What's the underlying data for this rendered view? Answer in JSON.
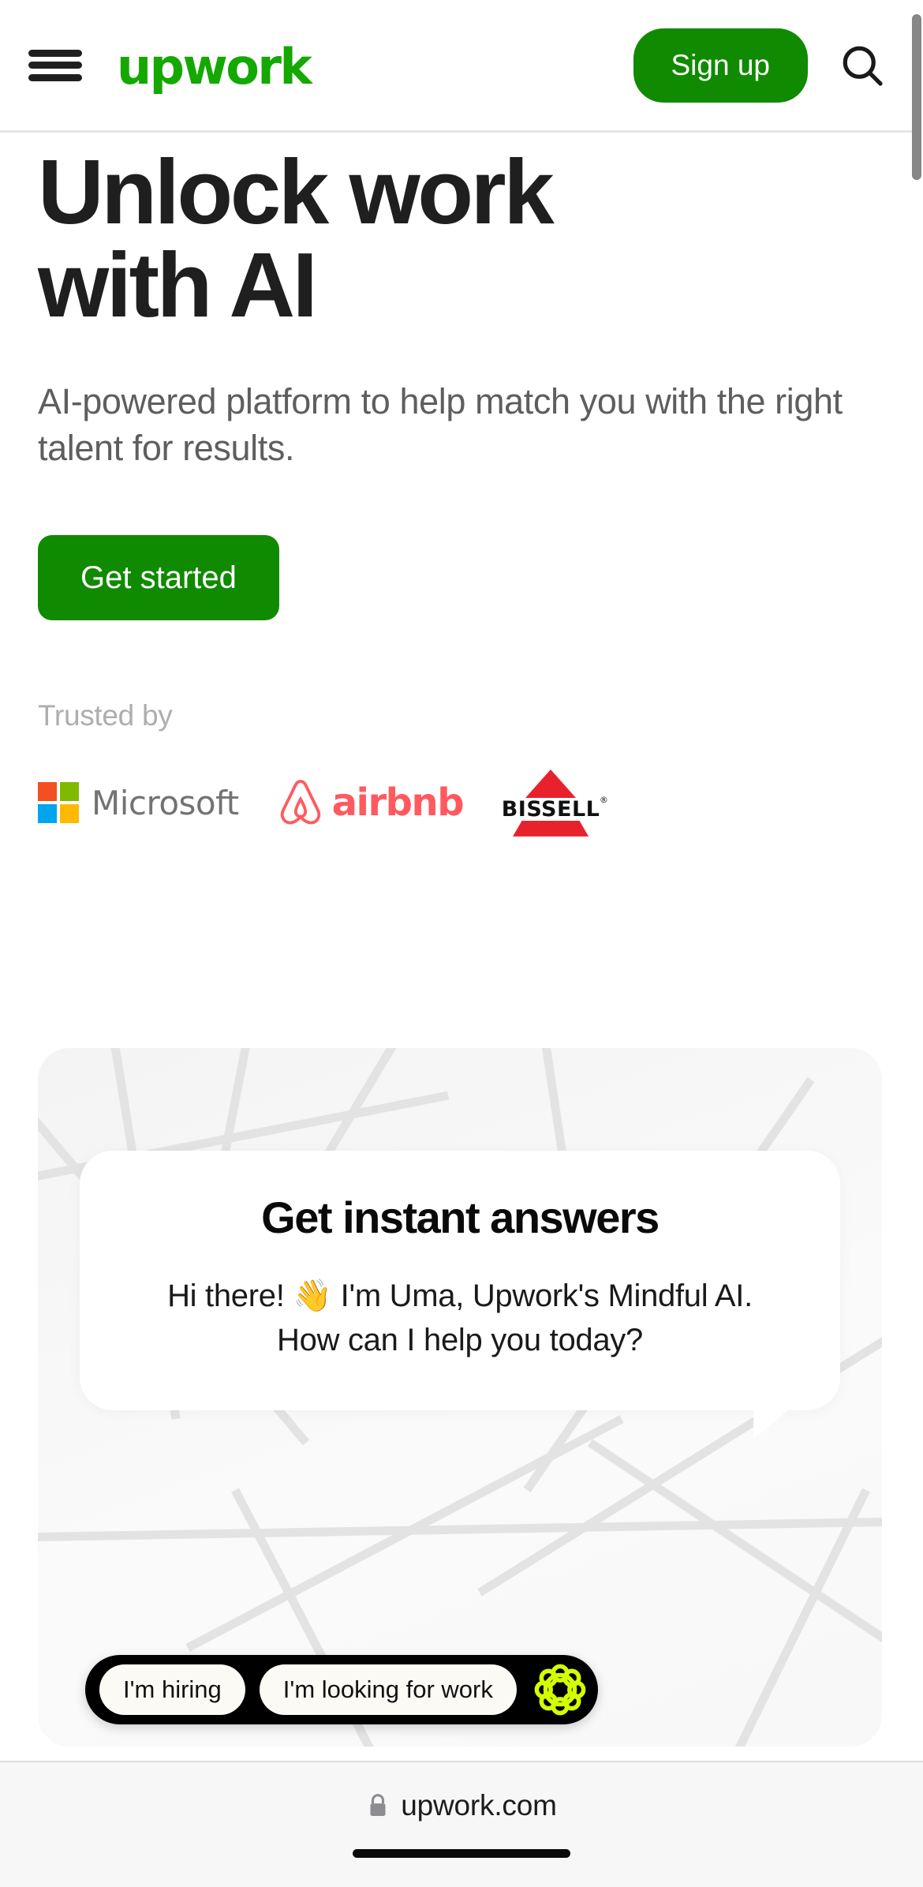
{
  "header": {
    "menu_icon": "hamburger-menu-icon",
    "brand": "upwork",
    "signup_label": "Sign up",
    "search_icon": "search-icon"
  },
  "hero": {
    "title_line1": "Unlock work",
    "title_line2": "with AI",
    "subtitle": "AI-powered platform to help match you with the right talent for results.",
    "cta_label": "Get started",
    "trusted_label": "Trusted by",
    "logos": [
      {
        "name": "Microsoft",
        "word": "Microsoft",
        "colors": [
          "#F25022",
          "#7FBA00",
          "#00A4EF",
          "#FFB900"
        ]
      },
      {
        "name": "airbnb",
        "word": "airbnb",
        "color": "#FF5A5F"
      },
      {
        "name": "BISSELL",
        "word": "BISSELL",
        "registered": "®",
        "color": "#E8222C"
      }
    ]
  },
  "chat": {
    "title": "Get instant answers",
    "message_line1": "Hi there! 👋 I'm Uma, Upwork's Mindful",
    "message_line2": "AI.",
    "message_line3": "How can I help you today?",
    "chips": [
      {
        "label": "I'm hiring"
      },
      {
        "label": "I'm looking for work"
      }
    ],
    "assistant_icon": "uma-logo-icon",
    "assistant_icon_color": "#D4FF00"
  },
  "browser": {
    "lock_icon": "lock-icon",
    "url": "upwork.com"
  },
  "colors": {
    "brand_green": "#14A800",
    "button_green": "#108A00",
    "text_dark": "#1F1F1F",
    "text_muted": "#5E5E5E",
    "text_light": "#AEAEAE"
  }
}
